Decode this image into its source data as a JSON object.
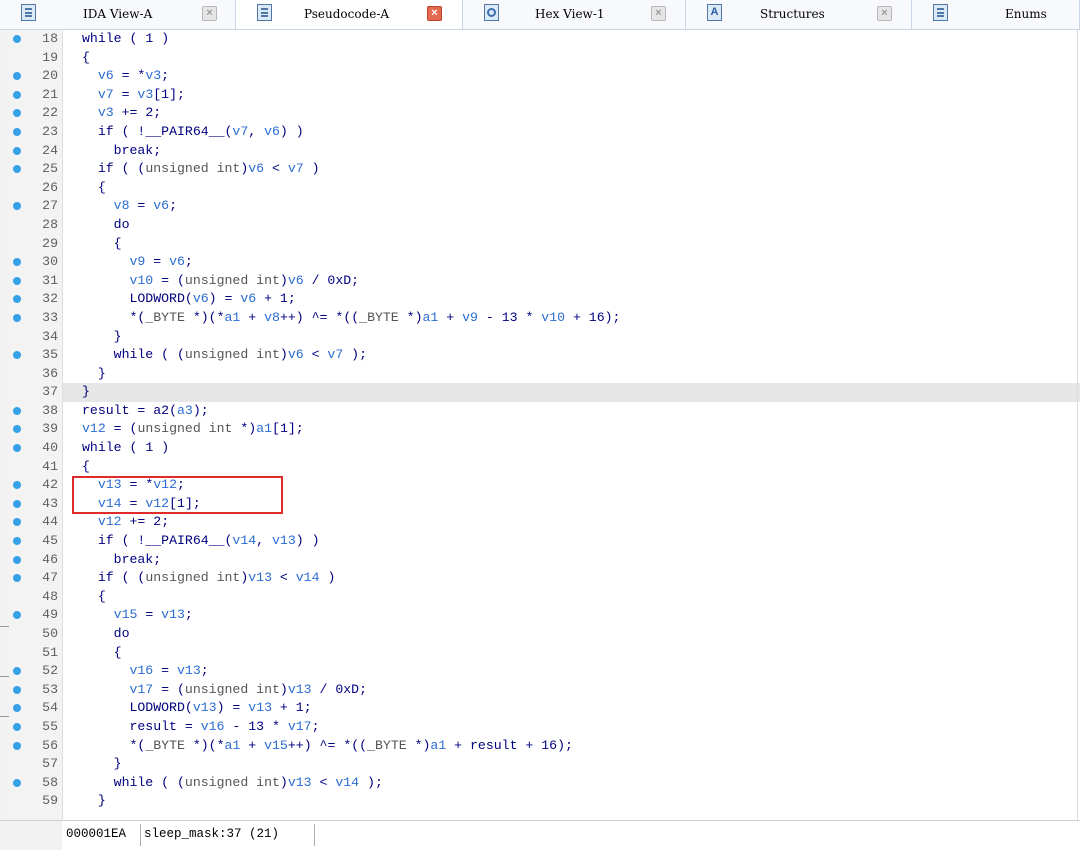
{
  "tabs": [
    {
      "label": "IDA View-A",
      "icon": "disassembly-icon",
      "active": false
    },
    {
      "label": "Pseudocode-A",
      "icon": "pseudocode-icon",
      "active": true
    },
    {
      "label": "Hex View-1",
      "icon": "hex-icon",
      "active": false
    },
    {
      "label": "Structures",
      "icon": "structures-icon",
      "active": false
    },
    {
      "label": "Enums",
      "icon": "enums-icon",
      "active": false
    }
  ],
  "tab_close_glyph": "×",
  "colors": {
    "keyword_text": "#000080",
    "variable_text": "#2b6cd1",
    "type_text": "#555555",
    "breakpoint_dot": "#37a1e8",
    "selection_box": "#e02b2b",
    "current_line_highlight": "#e6e6e6"
  },
  "code": {
    "lines": [
      {
        "num": "18",
        "dot": true,
        "text": "while ( 1 )"
      },
      {
        "num": "19",
        "dot": false,
        "text": "{"
      },
      {
        "num": "20",
        "dot": true,
        "text": "  v6 = *v3;"
      },
      {
        "num": "21",
        "dot": true,
        "text": "  v7 = v3[1];"
      },
      {
        "num": "22",
        "dot": true,
        "text": "  v3 += 2;"
      },
      {
        "num": "23",
        "dot": true,
        "text": "  if ( !__PAIR64__(v7, v6) )"
      },
      {
        "num": "24",
        "dot": true,
        "text": "    break;"
      },
      {
        "num": "25",
        "dot": true,
        "text": "  if ( (unsigned int)v6 < v7 )"
      },
      {
        "num": "26",
        "dot": false,
        "text": "  {"
      },
      {
        "num": "27",
        "dot": true,
        "text": "    v8 = v6;"
      },
      {
        "num": "28",
        "dot": false,
        "text": "    do"
      },
      {
        "num": "29",
        "dot": false,
        "text": "    {"
      },
      {
        "num": "30",
        "dot": true,
        "text": "      v9 = v6;"
      },
      {
        "num": "31",
        "dot": true,
        "text": "      v10 = (unsigned int)v6 / 0xD;"
      },
      {
        "num": "32",
        "dot": true,
        "text": "      LODWORD(v6) = v6 + 1;"
      },
      {
        "num": "33",
        "dot": true,
        "text": "      *(_BYTE *)(*a1 + v8++) ^= *((_BYTE *)a1 + v9 - 13 * v10 + 16);"
      },
      {
        "num": "34",
        "dot": false,
        "text": "    }"
      },
      {
        "num": "35",
        "dot": true,
        "text": "    while ( (unsigned int)v6 < v7 );"
      },
      {
        "num": "36",
        "dot": false,
        "text": "  }"
      },
      {
        "num": "37",
        "dot": false,
        "text": "}",
        "highlight": true
      },
      {
        "num": "38",
        "dot": true,
        "text": "result = a2(a3);"
      },
      {
        "num": "39",
        "dot": true,
        "text": "v12 = (unsigned int *)a1[1];"
      },
      {
        "num": "40",
        "dot": true,
        "text": "while ( 1 )"
      },
      {
        "num": "41",
        "dot": false,
        "text": "{"
      },
      {
        "num": "42",
        "dot": true,
        "text": "  v13 = *v12;"
      },
      {
        "num": "43",
        "dot": true,
        "text": "  v14 = v12[1];"
      },
      {
        "num": "44",
        "dot": true,
        "text": "  v12 += 2;"
      },
      {
        "num": "45",
        "dot": true,
        "text": "  if ( !__PAIR64__(v14, v13) )"
      },
      {
        "num": "46",
        "dot": true,
        "text": "    break;"
      },
      {
        "num": "47",
        "dot": true,
        "text": "  if ( (unsigned int)v13 < v14 )"
      },
      {
        "num": "48",
        "dot": false,
        "text": "  {"
      },
      {
        "num": "49",
        "dot": true,
        "text": "    v15 = v13;"
      },
      {
        "num": "50",
        "dot": false,
        "text": "    do"
      },
      {
        "num": "51",
        "dot": false,
        "text": "    {"
      },
      {
        "num": "52",
        "dot": true,
        "text": "      v16 = v13;"
      },
      {
        "num": "53",
        "dot": true,
        "text": "      v17 = (unsigned int)v13 / 0xD;"
      },
      {
        "num": "54",
        "dot": true,
        "text": "      LODWORD(v13) = v13 + 1;"
      },
      {
        "num": "55",
        "dot": true,
        "text": "      result = v16 - 13 * v17;"
      },
      {
        "num": "56",
        "dot": true,
        "text": "      *(_BYTE *)(*a1 + v15++) ^= *((_BYTE *)a1 + result + 16);"
      },
      {
        "num": "57",
        "dot": false,
        "text": "    }"
      },
      {
        "num": "58",
        "dot": true,
        "text": "    while ( (unsigned int)v13 < v14 );"
      },
      {
        "num": "59",
        "dot": false,
        "text": "  }"
      }
    ]
  },
  "status": {
    "address": "000001EA",
    "location": "sleep_mask:37 (21)"
  }
}
